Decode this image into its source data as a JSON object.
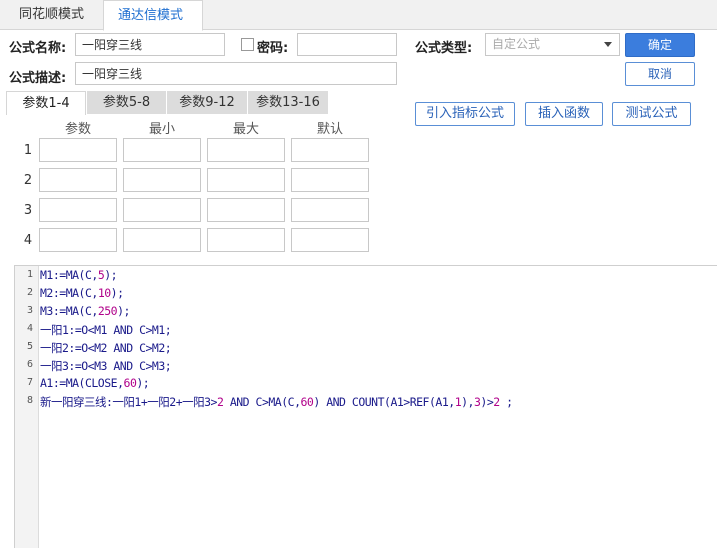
{
  "top_tabs": [
    "同花顺模式",
    "通达信模式"
  ],
  "form": {
    "name_label": "公式名称:",
    "name_value": "一阳穿三线",
    "password_label": "密码:",
    "password_value": "",
    "type_label": "公式类型:",
    "type_placeholder": "自定公式",
    "desc_label": "公式描述:",
    "desc_value": "一阳穿三线"
  },
  "buttons": {
    "ok": "确定",
    "cancel": "取消",
    "import_indicator": "引入指标公式",
    "insert_function": "插入函数",
    "test_formula": "测试公式"
  },
  "param_tabs": [
    "参数1-4",
    "参数5-8",
    "参数9-12",
    "参数13-16"
  ],
  "param_table": {
    "headers": [
      "参数",
      "最小",
      "最大",
      "默认"
    ],
    "rows": [
      "1",
      "2",
      "3",
      "4"
    ]
  },
  "editor": {
    "line_numbers": [
      "1",
      "2",
      "3",
      "4",
      "5",
      "6",
      "7",
      "8"
    ],
    "lines": [
      [
        {
          "t": "M1:=MA(C,",
          "c": ""
        },
        {
          "t": "5",
          "c": "n"
        },
        {
          "t": ");",
          "c": ""
        }
      ],
      [
        {
          "t": "M2:=MA(C,",
          "c": ""
        },
        {
          "t": "10",
          "c": "n"
        },
        {
          "t": ");",
          "c": ""
        }
      ],
      [
        {
          "t": "M3:=MA(C,",
          "c": ""
        },
        {
          "t": "250",
          "c": "n"
        },
        {
          "t": ");",
          "c": ""
        }
      ],
      [
        {
          "t": "一阳1:=O<M1 AND C>M1;",
          "c": ""
        }
      ],
      [
        {
          "t": "一阳2:=O<M2 AND C>M2;",
          "c": ""
        }
      ],
      [
        {
          "t": "一阳3:=O<M3 AND C>M3;",
          "c": ""
        }
      ],
      [
        {
          "t": "A1:=MA(CLOSE,",
          "c": ""
        },
        {
          "t": "60",
          "c": "n"
        },
        {
          "t": ");",
          "c": ""
        }
      ],
      [
        {
          "t": "新一阳穿三线:一阳1+一阳2+一阳3>",
          "c": ""
        },
        {
          "t": "2",
          "c": "n"
        },
        {
          "t": " AND C>MA(C,",
          "c": ""
        },
        {
          "t": "60",
          "c": "n"
        },
        {
          "t": ") AND COUNT(A1>REF(A1,",
          "c": ""
        },
        {
          "t": "1",
          "c": "n"
        },
        {
          "t": "),",
          "c": ""
        },
        {
          "t": "3",
          "c": "n"
        },
        {
          "t": ")>",
          "c": ""
        },
        {
          "t": "2",
          "c": "n"
        },
        {
          "t": " ;",
          "c": ""
        }
      ]
    ]
  }
}
